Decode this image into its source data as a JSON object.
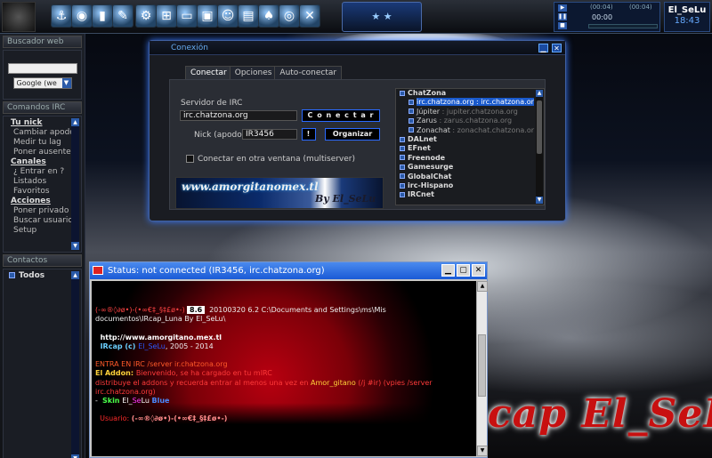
{
  "topbar": {
    "center_badge": "★ ★",
    "player": {
      "time_left": "(00:04)",
      "time_right": "(00:04)",
      "time": "00:00"
    },
    "user": {
      "name": "El_SeLu",
      "clock": "18:43"
    }
  },
  "sidebar": {
    "search": {
      "title": "Buscador web",
      "engine": "Google (we"
    },
    "commands": {
      "title": "Comandos IRC",
      "sections": [
        {
          "label": "Tu nick",
          "items": [
            "Cambiar apodo",
            "Medir tu lag",
            "Poner ausente"
          ]
        },
        {
          "label": "Canales",
          "items": [
            "¿ Entrar en ?",
            "Listados",
            "Favoritos"
          ]
        },
        {
          "label": "Acciones",
          "items": [
            "Poner privado",
            "Buscar usuario",
            "Setup"
          ]
        }
      ]
    },
    "contacts": {
      "title": "Contactos",
      "group": "Todos"
    }
  },
  "conexion": {
    "title": "Conexión",
    "tabs": [
      "Conectar",
      "Opciones",
      "Auto-conectar"
    ],
    "server_label": "Servidor de IRC",
    "server_value": "irc.chatzona.org",
    "connect_button": "C o n e c t a r",
    "nick_label": "Nick (apodo)",
    "nick_value": "IR3456",
    "bang_button": "!",
    "organize_button": "Organizar",
    "multiserver_label": "Conectar en otra ventana (multiserver)",
    "banner_line1": "www.amorgitanomex.tl",
    "banner_line2": "By El_SeLu",
    "tree": [
      {
        "name": "ChatZona",
        "children": [
          {
            "a": "irc.chatzona.org",
            "b": " : irc.chatzona.or",
            "selected": true
          },
          {
            "a": "Júpiter",
            "b": " : jupiter.chatzona.org"
          },
          {
            "a": "Zarus",
            "b": " : zarus.chatzona.org"
          },
          {
            "a": "Zonachat",
            "b": " : zonachat.chatzona.or"
          }
        ]
      },
      {
        "name": "DALnet"
      },
      {
        "name": "EFnet"
      },
      {
        "name": "Freenode"
      },
      {
        "name": "Gamesurge"
      },
      {
        "name": "GlobalChat"
      },
      {
        "name": "irc-Hispano"
      },
      {
        "name": "IRCnet"
      }
    ]
  },
  "status_window": {
    "title": "Status: not connected (IR3456, irc.chatzona.org)",
    "lines": [
      {
        "parts": [
          {
            "t": "(-∞®◊∂ø•)-(•∞€‡_§‡£ø•-) ",
            "c": "#ff4444"
          },
          {
            "t": " 8.6 ",
            "c": "#000",
            "bg": "#fff"
          },
          {
            "t": "  20100320 6.2 C:\\Documents and Settings\\ms\\Mis",
            "c": "#eee"
          }
        ]
      },
      {
        "parts": [
          {
            "t": "documentos\\IRcap_Luna By El_SeLu\\",
            "c": "#eee"
          }
        ]
      },
      {
        "parts": [
          {
            "t": " ",
            "c": "#eee"
          }
        ]
      },
      {
        "parts": [
          {
            "t": "  http://www.amorgitano.mex.tl",
            "c": "#fff",
            "b": true
          }
        ]
      },
      {
        "parts": [
          {
            "t": "  IRcap (c) ",
            "c": "#6ad0ff",
            "b": true
          },
          {
            "t": "El_SeLu",
            "c": "#2a5aff"
          },
          {
            "t": ", 2005 - 2014",
            "c": "#eee"
          }
        ]
      },
      {
        "parts": [
          {
            "t": " ",
            "c": "#eee"
          }
        ]
      },
      {
        "parts": [
          {
            "t": "ENTRA EN IRC /server ir.chatzona.org",
            "c": "#ff5a2a"
          }
        ]
      },
      {
        "parts": [
          {
            "t": "El Addon: ",
            "c": "#ffd23a",
            "b": true
          },
          {
            "t": "Bienvenido, se ha cargado en tu ",
            "c": "#ff3a3a"
          },
          {
            "t": "mIRC",
            "c": "#ff3a3a"
          }
        ]
      },
      {
        "parts": [
          {
            "t": "distribuye el addons y recuerda entrar al menos una vez en ",
            "c": "#ff3a3a"
          },
          {
            "t": "Amor_gitano",
            "c": "#ffd23a"
          },
          {
            "t": " (/j #ir) (vpies /server",
            "c": "#ff3a3a"
          }
        ]
      },
      {
        "parts": [
          {
            "t": "irc.chatzona.org)",
            "c": "#ff3a3a"
          }
        ]
      },
      {
        "parts": [
          {
            "t": "-  ",
            "c": "#eee"
          },
          {
            "t": "Skin ",
            "c": "#4aff4a",
            "b": true
          },
          {
            "t": "El_",
            "c": "#fff"
          },
          {
            "t": "Se",
            "c": "#ff3aff"
          },
          {
            "t": "Lu ",
            "c": "#fff"
          },
          {
            "t": "Blue",
            "c": "#4a8aff",
            "b": true
          }
        ]
      },
      {
        "parts": [
          {
            "t": " ",
            "c": "#eee"
          }
        ]
      },
      {
        "parts": [
          {
            "t": "  Usuario: ",
            "c": "#ff2a2a"
          },
          {
            "t": "(-∞®◊∂ø•)-(•∞€‡_§‡£ø•-)",
            "c": "#ff8a8a",
            "b": true
          }
        ]
      }
    ]
  },
  "desktop": {
    "signature": "cap El_SeLu"
  }
}
